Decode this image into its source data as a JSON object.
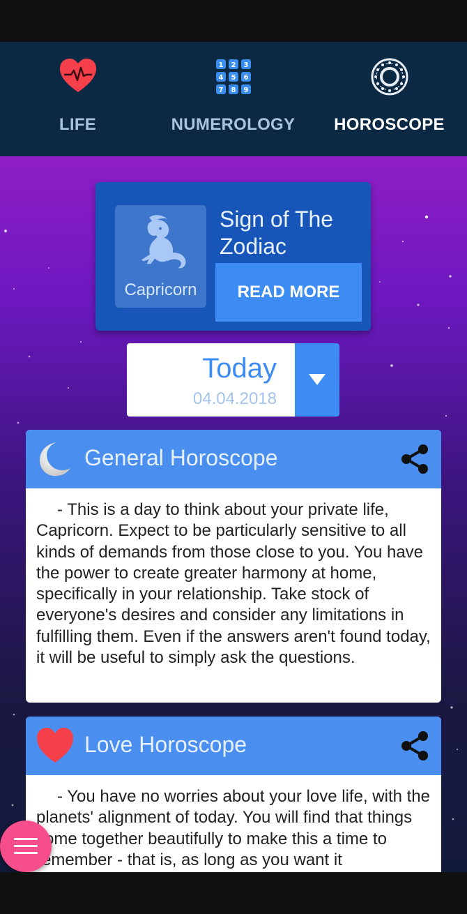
{
  "tabs": [
    {
      "label": "LIFE",
      "icon": "heart-pulse-icon",
      "active": false
    },
    {
      "label": "NUMEROLOGY",
      "icon": "number-grid-icon",
      "active": false
    },
    {
      "label": "HOROSCOPE",
      "icon": "zodiac-wheel-icon",
      "active": true
    }
  ],
  "zodiac": {
    "sign_name": "Capricorn",
    "sign_icon": "capricorn-icon",
    "title": "Sign of The Zodiac",
    "read_more_label": "READ MORE"
  },
  "date": {
    "label": "Today",
    "value": "04.04.2018"
  },
  "general": {
    "title": "General Horoscope",
    "icon": "moon-icon",
    "text": "- This is a day to think about your private life, Capricorn. Expect to be particularly sensitive to all kinds of demands from those close to you. You have the power to create greater harmony at home, specifically in your relationship. Take stock of everyone's desires and consider any limitations in fulfilling them. Even if the answers aren't found today, it will be useful to simply ask the questions."
  },
  "love": {
    "title": "Love Horoscope",
    "icon": "heart-icon",
    "text": "- You have no worries about your love life, with the planets' alignment of today. You will find that things come together beautifully to make this a time to remember - that is, as long as you want it"
  },
  "fab": {
    "icon": "menu-icon"
  },
  "colors": {
    "tabbar": "#0b2942",
    "accent": "#3c8cf3",
    "card_header": "#4a8ff0",
    "zodiac_card": "#1855b9",
    "fab": "#f64e8a",
    "heart": "#f5404b"
  }
}
